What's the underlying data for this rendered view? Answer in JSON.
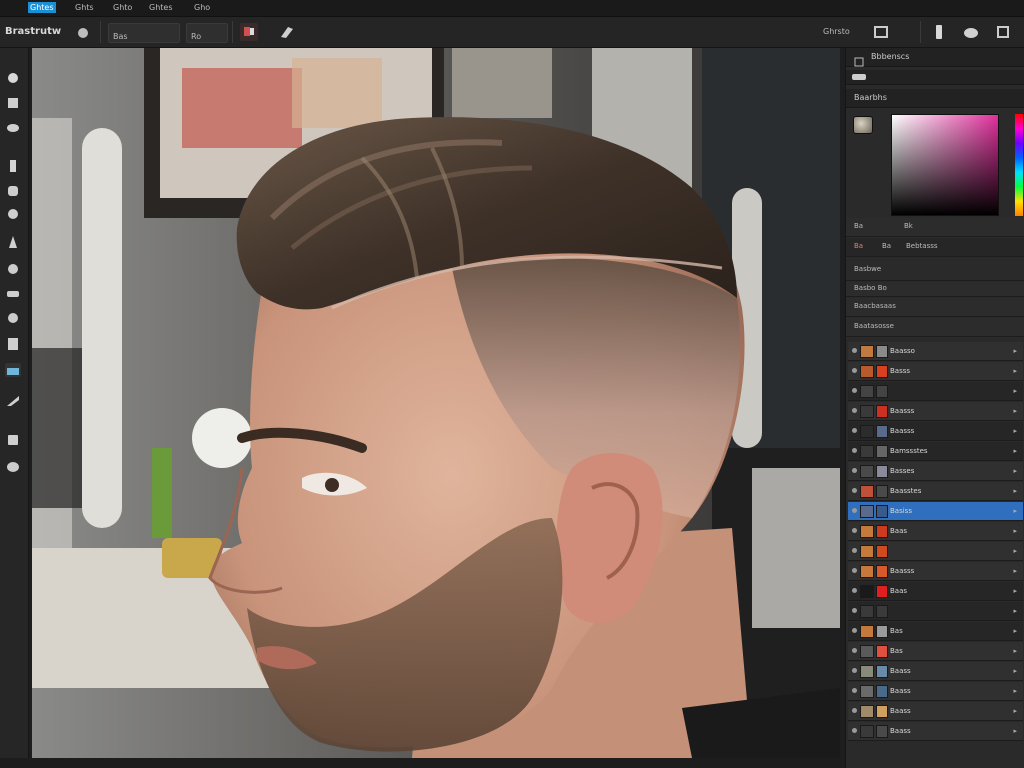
{
  "menu": {
    "items": [
      "Ghtes",
      "Ghts",
      "Ghto",
      "Ghtes",
      "Gho"
    ]
  },
  "options_bar": {
    "app_title": "Brastrutw",
    "preset_label": "Bas",
    "mode_label": "Ro",
    "right_label": "Ghrsto"
  },
  "tools": [
    "move-tool-icon",
    "marquee-tool-icon",
    "lasso-tool-icon",
    "crop-tool-icon",
    "eyedropper-tool-icon",
    "healing-tool-icon",
    "brush-tool-icon",
    "stamp-tool-icon",
    "eraser-tool-icon",
    "gradient-tool-icon",
    "blur-tool-icon",
    "dodge-tool-icon",
    "pen-tool-icon",
    "text-tool-icon",
    "shape-tool-icon"
  ],
  "panels": {
    "top_title": "Bbbenscs",
    "color_title": "Baarbhs",
    "color_info_a": "Ba",
    "color_info_b": "Bk",
    "tabs": [
      "Ba",
      "Ba",
      "Bebtasss"
    ],
    "section_title": "Basbwe",
    "mode_row": "Basbo  Bo",
    "row1": "Baacbasaas",
    "row2": "Baatasosse"
  },
  "layers": [
    {
      "name": "Baasso",
      "thumb": "#c07a40",
      "thumb2": "#8a8a8a",
      "style": "normal",
      "selected": false
    },
    {
      "name": "Basss",
      "thumb": "#b85a2a",
      "thumb2": "#d84020",
      "style": "normal",
      "selected": false
    },
    {
      "name": "",
      "thumb": "#444444",
      "thumb2": "#444444",
      "style": "dark",
      "selected": false
    },
    {
      "name": "Baasss",
      "thumb": "#3a3a3a",
      "thumb2": "#cc3020",
      "style": "normal",
      "selected": false
    },
    {
      "name": "Baasss",
      "thumb": "#2c2c2c",
      "thumb2": "#5a6a8a",
      "style": "dark",
      "selected": false
    },
    {
      "name": "Bamssstes",
      "thumb": "#3a3a3a",
      "thumb2": "#666666",
      "style": "dark",
      "selected": false
    },
    {
      "name": "Basses",
      "thumb": "#4a4a4a",
      "thumb2": "#8a8a9a",
      "style": "normal",
      "selected": false
    },
    {
      "name": "Baasstes",
      "thumb": "#c0503a",
      "thumb2": "#4a4a4a",
      "style": "normal",
      "selected": false
    },
    {
      "name": "Basiss",
      "thumb": "#5a6a8a",
      "thumb2": "#3a5a8a",
      "style": "normal",
      "selected": true
    },
    {
      "name": "Baas",
      "thumb": "#c47a3a",
      "thumb2": "#cc3a20",
      "style": "normal",
      "selected": false
    },
    {
      "name": "",
      "thumb": "#c47a3a",
      "thumb2": "#d04a20",
      "style": "normal",
      "selected": false
    },
    {
      "name": "Baasss",
      "thumb": "#c8783a",
      "thumb2": "#d85a2a",
      "style": "normal",
      "selected": false
    },
    {
      "name": "Baas",
      "thumb": "#1a1a1a",
      "thumb2": "#e02020",
      "style": "dark",
      "selected": false
    },
    {
      "name": "",
      "thumb": "#3a3a3a",
      "thumb2": "#3a3a3a",
      "style": "dark",
      "selected": false
    },
    {
      "name": "Bas",
      "thumb": "#c47a3a",
      "thumb2": "#9a9a9a",
      "style": "dark",
      "selected": false
    },
    {
      "name": "Bas",
      "thumb": "#5a5a5a",
      "thumb2": "#e05040",
      "style": "normal",
      "selected": false
    },
    {
      "name": "Baass",
      "thumb": "#8a8a7a",
      "thumb2": "#6a8aaa",
      "style": "normal",
      "selected": false
    },
    {
      "name": "Baass",
      "thumb": "#6a6a6a",
      "thumb2": "#4a6a8a",
      "style": "normal",
      "selected": false
    },
    {
      "name": "Baass",
      "thumb": "#a08a6a",
      "thumb2": "#d0a060",
      "style": "normal",
      "selected": false
    },
    {
      "name": "Baass",
      "thumb": "#3a3a3a",
      "thumb2": "#4a4a4a",
      "style": "normal",
      "selected": false
    }
  ]
}
